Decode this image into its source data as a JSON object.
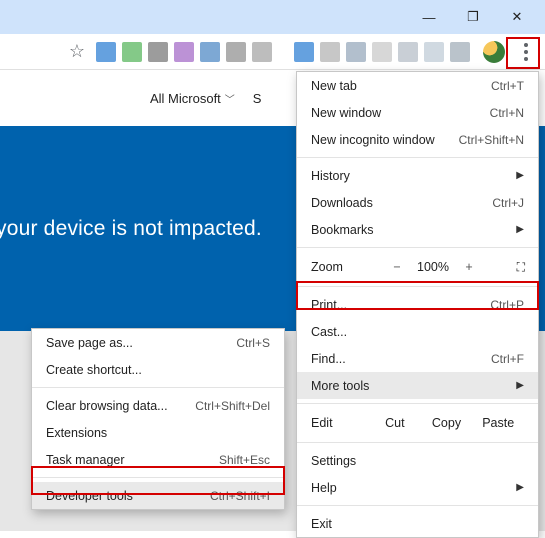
{
  "window": {
    "minimize": "—",
    "maximize": "❐",
    "close": "✕"
  },
  "page": {
    "nav_label": "All Microsoft",
    "search_label": "S",
    "banner_text": "your device is not impacted."
  },
  "main_menu": {
    "new_tab": "New tab",
    "new_tab_sc": "Ctrl+T",
    "new_window": "New window",
    "new_window_sc": "Ctrl+N",
    "new_incognito": "New incognito window",
    "new_incognito_sc": "Ctrl+Shift+N",
    "history": "History",
    "downloads": "Downloads",
    "downloads_sc": "Ctrl+J",
    "bookmarks": "Bookmarks",
    "zoom_label": "Zoom",
    "zoom_minus": "−",
    "zoom_pct": "100%",
    "zoom_plus": "+",
    "fullscreen": "⛶",
    "print": "Print...",
    "print_sc": "Ctrl+P",
    "cast": "Cast...",
    "find": "Find...",
    "find_sc": "Ctrl+F",
    "more_tools": "More tools",
    "edit_label": "Edit",
    "cut": "Cut",
    "copy": "Copy",
    "paste": "Paste",
    "settings": "Settings",
    "help": "Help",
    "exit": "Exit"
  },
  "submenu": {
    "save_page": "Save page as...",
    "save_page_sc": "Ctrl+S",
    "create_shortcut": "Create shortcut...",
    "clear_data": "Clear browsing data...",
    "clear_data_sc": "Ctrl+Shift+Del",
    "extensions": "Extensions",
    "task_manager": "Task manager",
    "task_manager_sc": "Shift+Esc",
    "developer_tools": "Developer tools",
    "developer_tools_sc": "Ctrl+Shift+I"
  }
}
